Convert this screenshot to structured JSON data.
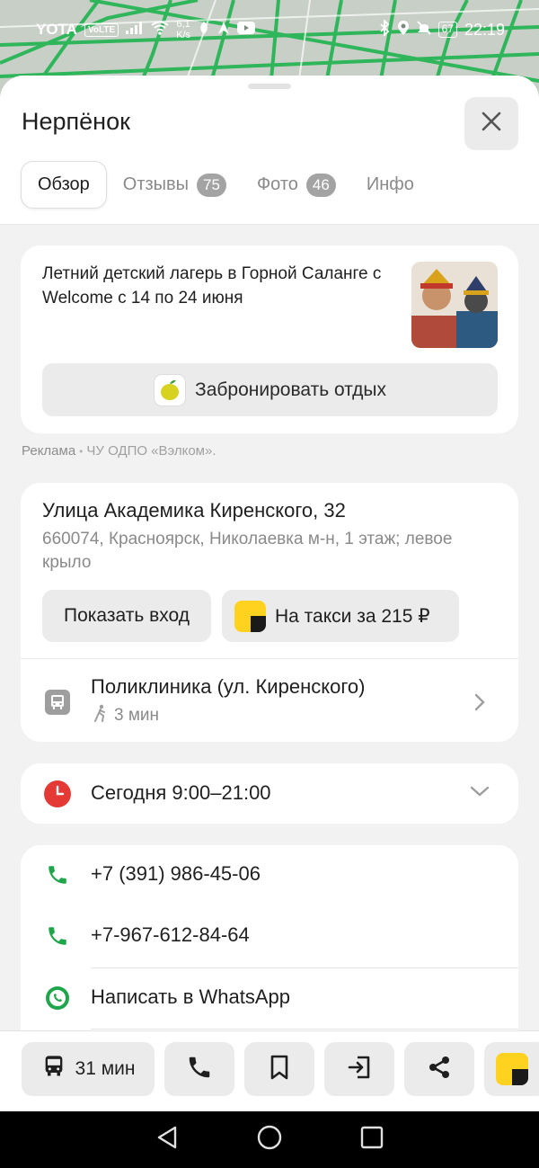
{
  "status_bar": {
    "carrier": "YOTA",
    "volte": "VoLTE",
    "speed_value": "6,1",
    "speed_unit": "K/s",
    "battery": "67",
    "time": "22:19"
  },
  "place": {
    "title": "Нерпёнок"
  },
  "tabs": [
    {
      "label": "Обзор",
      "active": true
    },
    {
      "label": "Отзывы",
      "count": "75"
    },
    {
      "label": "Фото",
      "count": "46"
    },
    {
      "label": "Инфо"
    }
  ],
  "ad": {
    "text": "Летний детский лагерь в Горной Саланге с Welcome с 14 по 24 июня",
    "button_label": "Забронировать отдых",
    "note_label": "Реклама",
    "note_org": "ЧУ ОДПО «Вэлком»."
  },
  "address": {
    "street": "Улица Академика Киренского, 32",
    "details": "660074, Красноярск, Николаевка м-н, 1 этаж; левое крыло",
    "entrance_button": "Показать вход",
    "taxi_button": "На такси за 215 ₽",
    "stop_name": "Поликлиника (ул. Киренского)",
    "stop_walk": "3 мин"
  },
  "hours": {
    "text": "Сегодня 9:00–21:00"
  },
  "contacts": {
    "phone1": "+7 (391) 986-45-06",
    "phone2": "+7-967-612-84-64",
    "whatsapp": "Написать в WhatsApp"
  },
  "action_bar": {
    "route_time": "31 мин"
  },
  "colors": {
    "accent_green": "#1fa54a",
    "clock_red": "#e53935",
    "taxi_yellow": "#ffd21f"
  }
}
